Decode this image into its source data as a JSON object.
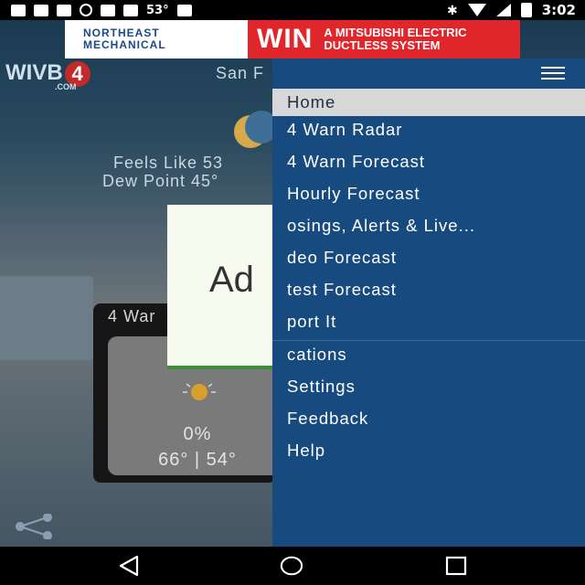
{
  "status_bar": {
    "temperature": "53°",
    "time": "3:02"
  },
  "ad_banner": {
    "brand_line1": "NORTHEAST",
    "brand_line2": "MECHANICAL",
    "headline": "WIN",
    "sub_line1": "A MITSUBISHI ELECTRIC",
    "sub_line2": "DUCTLESS SYSTEM"
  },
  "header": {
    "logo_text": "WIVB",
    "logo_badge": "4",
    "logo_domain": ".COM",
    "city": "San F"
  },
  "conditions": {
    "feels_like": "Feels Like  53",
    "dew_point": "Dew Point  45°"
  },
  "forecast_card": {
    "title": "4 War",
    "precip": "0%",
    "temps": "66° | 54°"
  },
  "ad_box": {
    "label": "Ad"
  },
  "drawer": {
    "items": [
      {
        "label": "Home",
        "active": true
      },
      {
        "label": "4 Warn Radar"
      },
      {
        "label": "4 Warn Forecast"
      },
      {
        "label": "Hourly Forecast"
      },
      {
        "label": "osings, Alerts & Live..."
      },
      {
        "label": "deo Forecast"
      },
      {
        "label": "test Forecast"
      },
      {
        "label": "port It"
      },
      {
        "label": "cations"
      },
      {
        "label": "Settings"
      },
      {
        "label": "Feedback"
      },
      {
        "label": "Help"
      }
    ]
  },
  "colors": {
    "drawer": "#174b80",
    "active_item": "#d7d7d7",
    "ad_red": "#e0262a"
  }
}
